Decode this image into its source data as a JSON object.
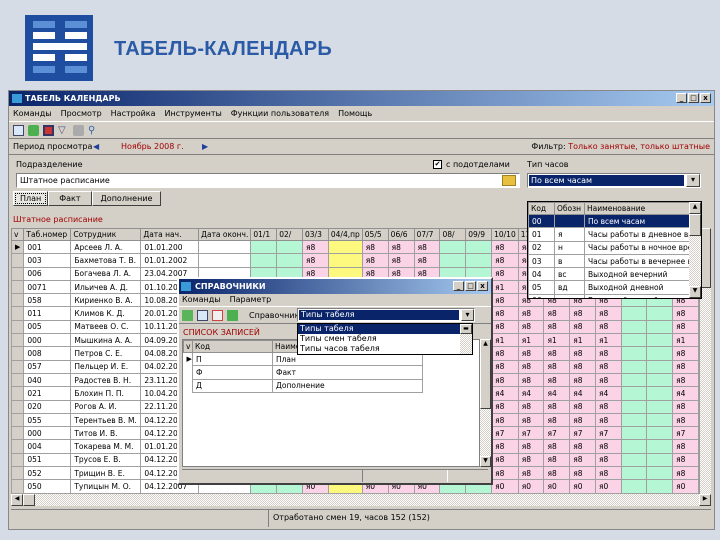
{
  "slide": {
    "title": "ТАБЕЛЬ-КАЛЕНДАРЬ"
  },
  "window": {
    "title": "ТАБЕЛЬ КАЛЕНДАРЬ",
    "menu": [
      "Команды",
      "Просмотр",
      "Настройка",
      "Инструменты",
      "Функции пользователя",
      "Помощь"
    ],
    "toolbar_icons": [
      "edit-icon",
      "refresh-icon",
      "report-icon",
      "filter-icon",
      "print-icon",
      "preview-icon"
    ],
    "period_label": "Период просмотра",
    "period_value": "Ноябрь 2008 г.",
    "filter_label": "Фильтр:",
    "filter_value": "Только занятые, только штатные",
    "subdivision_label": "Подразделение",
    "subdivision_value": "Штатное расписание",
    "with_subdivisions_label": "с подотделами",
    "with_subdivisions_checked": true,
    "hours_type_label": "Тип часов",
    "hours_type_value": "По всем часам",
    "tabs": [
      "План",
      "Факт",
      "Дополнение"
    ],
    "active_tab": "План",
    "section_caption": "Штатное расписание",
    "status": "Отработано смен 19, часов 152 (152)",
    "colors": {
      "green": "#b5f7d4",
      "pink": "#fbd3e6",
      "yellow": "#fcf97e",
      "selection": "#0a246a",
      "caption_red": "#a00000"
    }
  },
  "grid": {
    "columns": [
      "Таб.номер",
      "Сотрудник",
      "Дата нач.",
      "Дата оконч."
    ],
    "day_columns": [
      "01/1",
      "02/",
      "03/3",
      "04/4,пр",
      "05/5",
      "06/6",
      "07/7",
      "08/",
      "09/9",
      "10/10",
      "11",
      "12",
      "13",
      "14",
      "15",
      "16",
      "17"
    ],
    "day_colors": [
      "green",
      "green",
      "pink",
      "yellow",
      "pink",
      "pink",
      "pink",
      "green",
      "green",
      "pink",
      "pink",
      "pink",
      "pink",
      "pink",
      "green",
      "green",
      "pink"
    ],
    "rows": [
      {
        "num": "001",
        "name": "Арсеев Л. А.",
        "start": "01.01.200",
        "value": "я8"
      },
      {
        "num": "003",
        "name": "Бахметова Т. В.",
        "start": "01.01.2002",
        "value": "я8"
      },
      {
        "num": "006",
        "name": "Богачева Л. А.",
        "start": "23.04.2007",
        "value": "я8"
      },
      {
        "num": "0071",
        "name": "Ильичев А. Д.",
        "start": "01.10.201",
        "value": "я1"
      },
      {
        "num": "058",
        "name": "Кириенко В. А.",
        "start": "10.08.200",
        "value": "я8"
      },
      {
        "num": "011",
        "name": "Климов К. Д.",
        "start": "20.01.200",
        "value": "я8"
      },
      {
        "num": "005",
        "name": "Матвеев О. С.",
        "start": "10.11.200",
        "value": "я8"
      },
      {
        "num": "000",
        "name": "Мышкина А. А.",
        "start": "04.09.201",
        "value": "я1"
      },
      {
        "num": "008",
        "name": "Петров С. Е.",
        "start": "04.08.200",
        "value": "я8"
      },
      {
        "num": "057",
        "name": "Пельцер И. Е.",
        "start": "04.02.200",
        "value": "я8"
      },
      {
        "num": "040",
        "name": "Радостев В. Н.",
        "start": "23.11.200",
        "value": "я8"
      },
      {
        "num": "021",
        "name": "Блохин П. П.",
        "start": "10.04.200",
        "value": "я4"
      },
      {
        "num": "020",
        "name": "Рогов А. И.",
        "start": "22.11.200",
        "value": "я8"
      },
      {
        "num": "055",
        "name": "Терентьев В. М.",
        "start": "04.12.200",
        "value": "я8"
      },
      {
        "num": "000",
        "name": "Титов И. В.",
        "start": "04.12.200",
        "value": "я7"
      },
      {
        "num": "004",
        "name": "Токарева М. М.",
        "start": "01.01.200",
        "value": "я8"
      },
      {
        "num": "051",
        "name": "Трусов Е. В.",
        "start": "04.12.200",
        "value": "я8"
      },
      {
        "num": "052",
        "name": "Трищин В. Е.",
        "start": "04.12.200",
        "value": "я8"
      },
      {
        "num": "050",
        "name": "Тупицын М. О.",
        "start": "04.12.2007",
        "value": "я0"
      }
    ]
  },
  "hours_dropdown": {
    "headers": [
      "Код",
      "Обозн",
      "Наименование"
    ],
    "items": [
      {
        "code": "00",
        "mark": "",
        "name": "По всем часам"
      },
      {
        "code": "01",
        "mark": "я",
        "name": "Часы работы в дневное время"
      },
      {
        "code": "02",
        "mark": "н",
        "name": "Часы работы в ночное время"
      },
      {
        "code": "03",
        "mark": "в",
        "name": "Часы работы в вечернее время"
      },
      {
        "code": "04",
        "mark": "вс",
        "name": "Выходной вечерний"
      },
      {
        "code": "05",
        "mark": "вд",
        "name": "Выходной дневной"
      },
      {
        "code": "06",
        "mark": "вн",
        "name": "Выходной ночной"
      },
      {
        "code": "07",
        "mark": "с",
        "name": "Сверхурочные часы"
      }
    ]
  },
  "dialog": {
    "title": "СПРАВОЧНИКИ",
    "menu": [
      "Команды",
      "Параметр"
    ],
    "reference_label": "Справочник",
    "reference_value": "Типы табеля",
    "reference_options": [
      "Типы табеля",
      "Типы смен табеля",
      "Типы часов табеля"
    ],
    "caption": "СПИСОК ЗАПИСЕЙ",
    "headers": [
      "Код",
      "Наименование"
    ],
    "rows": [
      {
        "code": "П",
        "name": "План",
        "checked": false
      },
      {
        "code": "Ф",
        "name": "Факт",
        "checked": true
      },
      {
        "code": "Д",
        "name": "Дополнение",
        "checked": true
      }
    ]
  }
}
